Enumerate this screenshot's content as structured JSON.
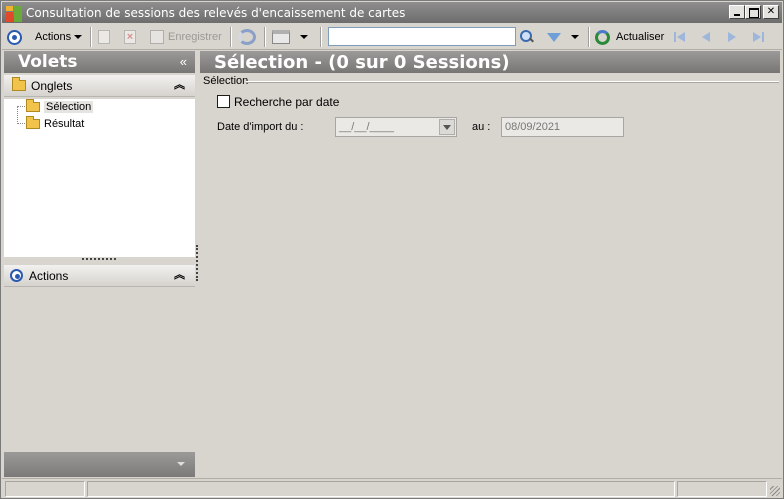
{
  "window": {
    "title": "Consultation de sessions des relevés d'encaissement de cartes"
  },
  "toolbar": {
    "actions_label": "Actions",
    "save_label": "Enregistrer",
    "search_value": "",
    "search_placeholder": "",
    "refresh_label": "Actualiser"
  },
  "left_panel": {
    "title": "Volets",
    "collapse_glyph": "«",
    "tabs_group": "Onglets",
    "tree": [
      {
        "label": "Sélection",
        "selected": true
      },
      {
        "label": "Résultat",
        "selected": false
      }
    ],
    "actions_group": "Actions"
  },
  "main": {
    "header": "Sélection - (0 sur 0 Sessions)",
    "fieldset_legend": "Sélection",
    "checkbox_label": "Recherche par date",
    "checkbox_checked": false,
    "date_from_label": "Date d'import du :",
    "date_from_value": "__/__/____",
    "date_to_label": "au :",
    "date_to_value": "08/09/2021"
  },
  "colors": {
    "header_bg": "#8a8886",
    "accent_blue": "#2a5ab0",
    "folder": "#f1c34a"
  }
}
